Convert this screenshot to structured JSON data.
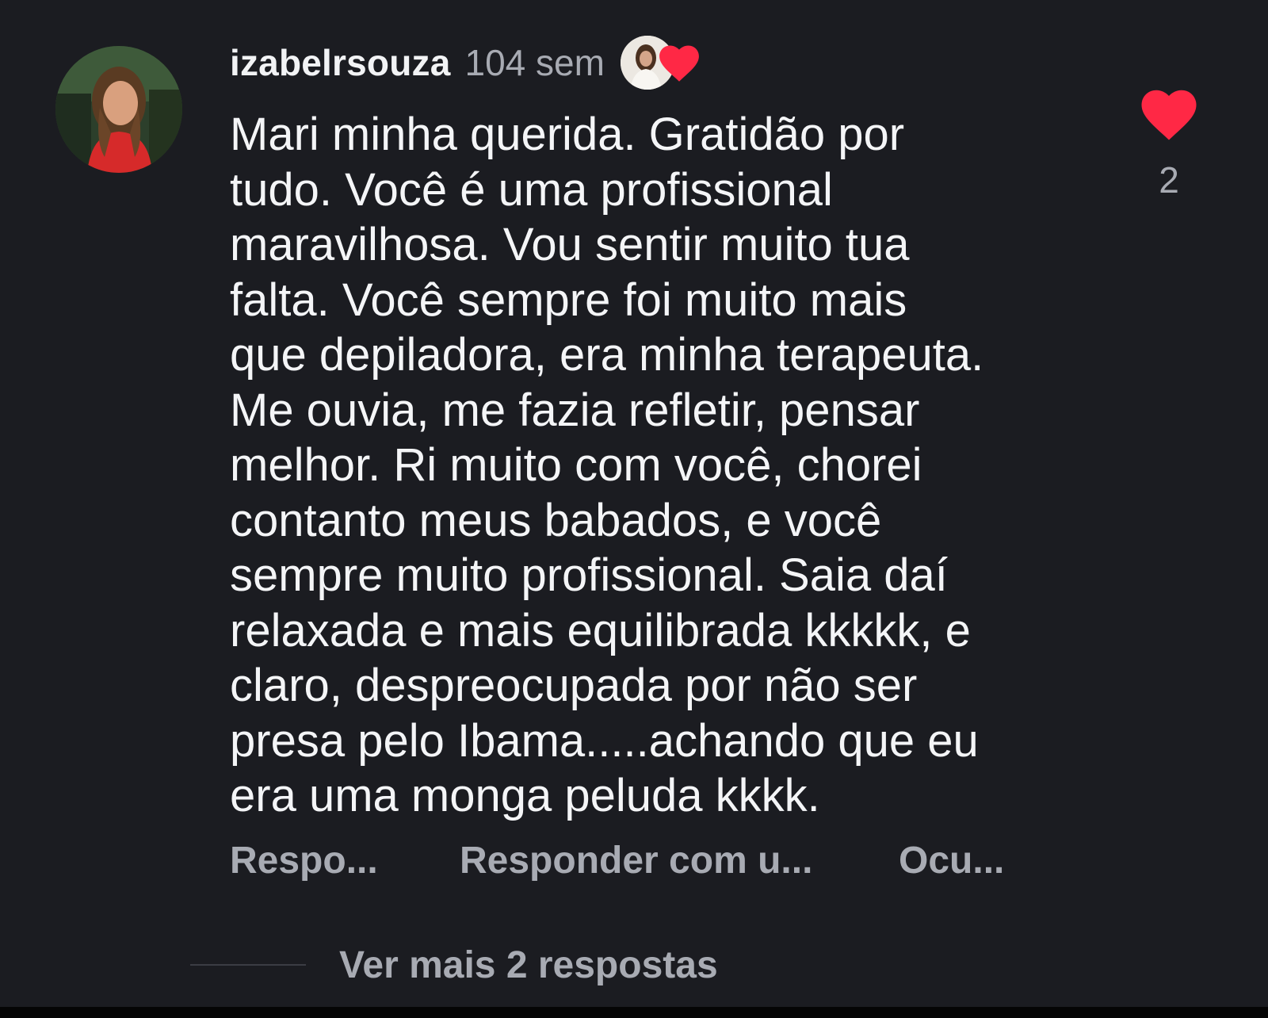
{
  "comment": {
    "username": "izabelrsouza",
    "time": "104 sem",
    "author_liked": true,
    "text_lines": [
      "Mari minha querida. Gratidão por",
      "tudo. Você é uma profissional",
      "maravilhosa. Vou sentir muito tua",
      "falta. Você sempre foi muito mais",
      "que depiladora, era minha terapeuta.",
      "Me ouvia, me fazia refletir, pensar",
      "melhor. Ri muito com você, chorei",
      "contanto meus babados, e você",
      "sempre muito profissional. Saia daí",
      "relaxada e mais equilibrada kkkkk, e",
      "claro, despreocupada por não ser",
      "presa pelo Ibama.....achando que eu",
      "era uma monga peluda kkkk."
    ],
    "like_count": "2",
    "liked": true
  },
  "actions": {
    "reply": "Respo...",
    "reply_with_gif": "Responder com u...",
    "hide": "Ocu..."
  },
  "more_replies": "Ver mais 2 respostas",
  "colors": {
    "background": "#1b1c21",
    "text": "#f4f5f7",
    "muted": "#a8abb3",
    "heart": "#ff2845"
  },
  "icons": {
    "like": "heart-icon",
    "author_like": "heart-icon"
  }
}
